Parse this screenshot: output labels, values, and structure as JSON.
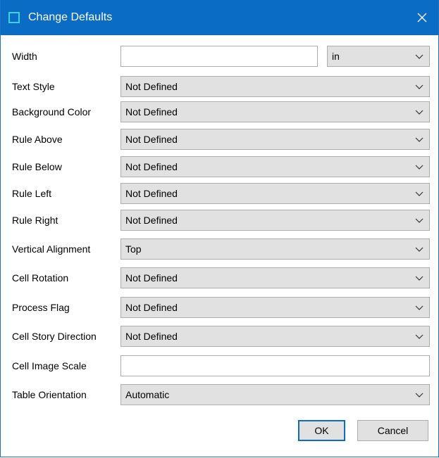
{
  "dialog": {
    "title": "Change Defaults",
    "close_symbol": "×",
    "accent_color": "#0a6cc4"
  },
  "fields": {
    "width": {
      "label": "Width",
      "value": "",
      "unit": "in"
    },
    "text_style": {
      "label": "Text Style",
      "value": "Not Defined"
    },
    "background_color": {
      "label": "Background Color",
      "value": "Not Defined"
    },
    "rule_above": {
      "label": "Rule Above",
      "value": "Not Defined"
    },
    "rule_below": {
      "label": "Rule Below",
      "value": "Not Defined"
    },
    "rule_left": {
      "label": "Rule Left",
      "value": "Not Defined"
    },
    "rule_right": {
      "label": "Rule Right",
      "value": "Not Defined"
    },
    "vertical_alignment": {
      "label": "Vertical Alignment",
      "value": "Top"
    },
    "cell_rotation": {
      "label": "Cell Rotation",
      "value": "Not Defined"
    },
    "process_flag": {
      "label": "Process Flag",
      "value": "Not Defined"
    },
    "cell_story_direction": {
      "label": "Cell Story Direction",
      "value": "Not Defined"
    },
    "cell_image_scale": {
      "label": "Cell Image Scale",
      "value": ""
    },
    "table_orientation": {
      "label": "Table Orientation",
      "value": "Automatic"
    }
  },
  "buttons": {
    "ok": "OK",
    "cancel": "Cancel"
  },
  "icons": {
    "window": "window-icon",
    "close": "close-icon",
    "dropdown": "chevron-down-icon"
  }
}
